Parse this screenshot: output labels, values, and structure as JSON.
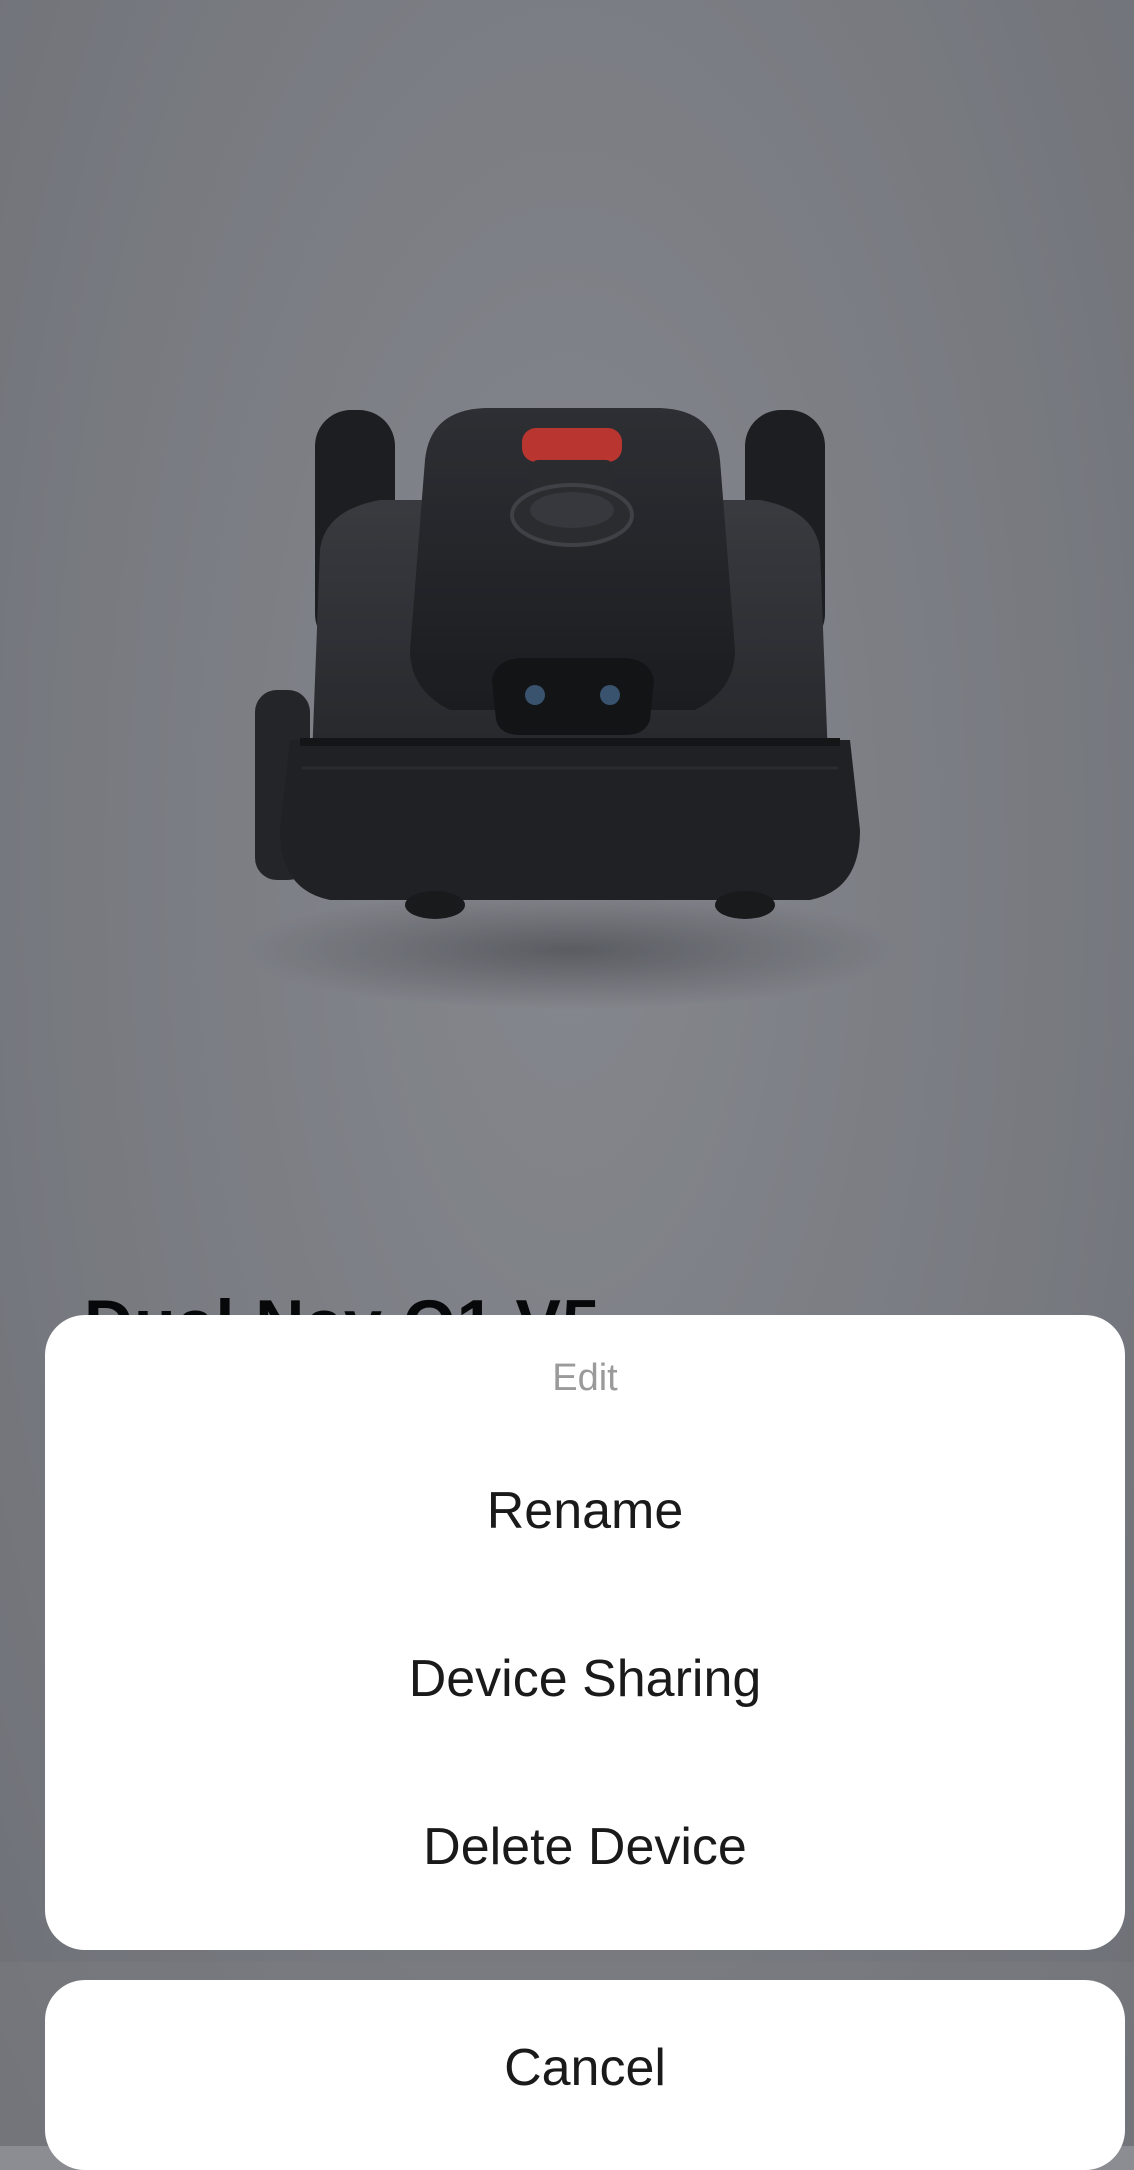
{
  "device": {
    "title": "Dual Nav Q1 V5"
  },
  "action_sheet": {
    "title": "Edit",
    "items": [
      {
        "label": "Rename"
      },
      {
        "label": "Device Sharing"
      },
      {
        "label": "Delete Device"
      }
    ],
    "cancel_label": "Cancel"
  },
  "colors": {
    "sheet_background": "#ffffff",
    "sheet_title": "#9a9a9a",
    "item_text": "#1a1a1a",
    "overlay": "#8b8d93",
    "mower_accent": "#d9382f"
  }
}
